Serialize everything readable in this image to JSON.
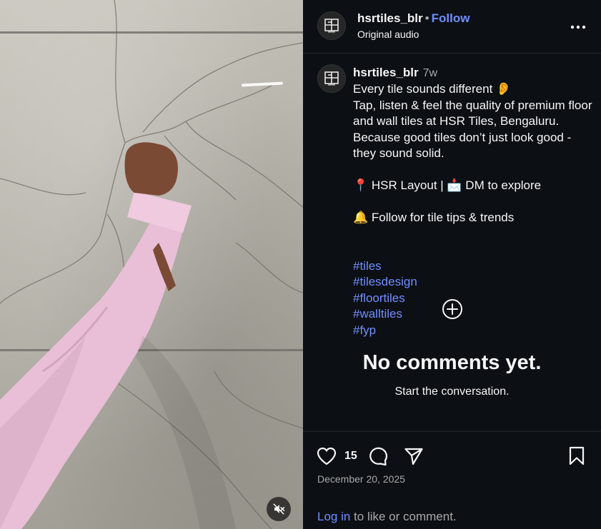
{
  "account": {
    "username": "hsrtiles_blr",
    "separator": "•",
    "follow_label": "Follow",
    "audio_label": "Original audio"
  },
  "caption": {
    "username": "hsrtiles_blr",
    "time_ago": "7w",
    "line1": "Every tile sounds different 👂",
    "line2": "Tap, listen & feel the quality of premium floor and wall tiles at HSR Tiles, Bengaluru. Because good tiles don’t just look good - they sound solid.",
    "line3": "📍 HSR Layout | 📩 DM to explore",
    "line4": "🔔 Follow for tile tips & trends",
    "hashtags": [
      "#tiles",
      "#tilesdesign",
      "#floortiles",
      "#walltiles",
      "#fyp"
    ]
  },
  "comments": {
    "empty_title": "No comments yet.",
    "empty_subtitle": "Start the conversation."
  },
  "actions": {
    "like_count": "15",
    "date": "December 20, 2025",
    "login_link": "Log in",
    "login_suffix": " to like or comment."
  },
  "icons": {
    "avatar": "tile-logo-icon",
    "more": "more-options-icon",
    "add_comment": "plus-circle-icon",
    "like": "heart-icon",
    "comment": "comment-bubble-icon",
    "share": "paper-plane-icon",
    "save": "bookmark-icon",
    "mute": "muted-speaker-icon"
  },
  "colors": {
    "background": "#0c1014",
    "link": "#708dff",
    "muted_text": "#a8a8a8",
    "divider": "#262626"
  }
}
